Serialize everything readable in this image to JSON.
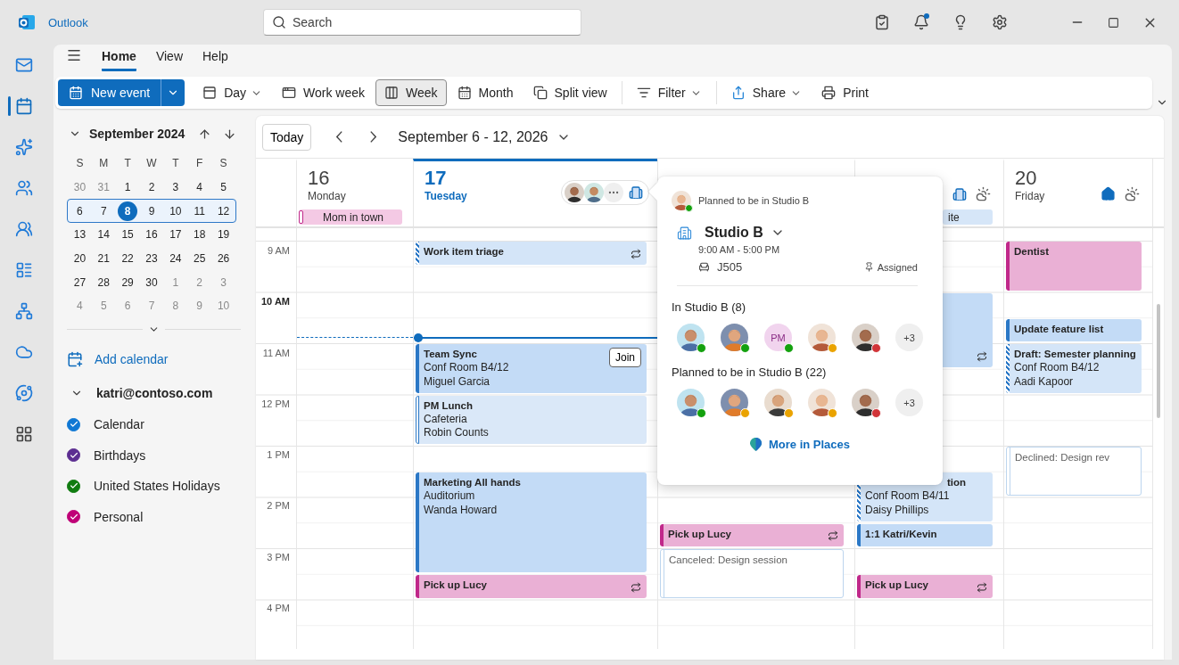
{
  "title_bar": {
    "app_name": "Outlook",
    "search_placeholder": "Search",
    "notification": true
  },
  "rail": [
    {
      "selected": false
    },
    {
      "selected": true
    },
    {
      "selected": false
    },
    {
      "selected": false
    },
    {
      "selected": false
    },
    {
      "selected": false
    },
    {
      "selected": false
    },
    {
      "selected": false
    },
    {
      "selected": false
    },
    {
      "selected": false
    }
  ],
  "tabs": [
    {
      "label": "Home",
      "selected": true
    },
    {
      "label": "View",
      "selected": false
    },
    {
      "label": "Help",
      "selected": false
    }
  ],
  "ribbon": {
    "new_event": "New event",
    "groups": [
      [
        {
          "kind": "view",
          "label": "Day",
          "dropdown": true,
          "selected": false
        },
        {
          "kind": "view",
          "label": "Work week",
          "dropdown": false,
          "selected": false
        },
        {
          "kind": "view",
          "label": "Week",
          "dropdown": false,
          "selected": true
        },
        {
          "kind": "view",
          "label": "Month",
          "dropdown": false,
          "selected": false
        },
        {
          "kind": "view",
          "label": "Split view",
          "dropdown": false,
          "selected": false
        }
      ],
      [
        {
          "kind": "action",
          "label": "Filter",
          "dropdown": true
        }
      ],
      [
        {
          "kind": "action",
          "label": "Share",
          "dropdown": true
        },
        {
          "kind": "action",
          "label": "Print",
          "dropdown": false
        }
      ]
    ]
  },
  "mini_calendar": {
    "month": "September 2024",
    "weekdays": [
      "S",
      "M",
      "T",
      "W",
      "T",
      "F",
      "S"
    ],
    "weeks": [
      {
        "selected": false,
        "days": [
          {
            "label": "30",
            "other_month": true,
            "selected": false
          },
          {
            "label": "31",
            "other_month": true,
            "selected": false
          },
          {
            "label": "1",
            "other_month": false,
            "selected": false
          },
          {
            "label": "2",
            "other_month": false,
            "selected": false
          },
          {
            "label": "3",
            "other_month": false,
            "selected": false
          },
          {
            "label": "4",
            "other_month": false,
            "selected": false
          },
          {
            "label": "5",
            "other_month": false,
            "selected": false
          }
        ]
      },
      {
        "selected": true,
        "days": [
          {
            "label": "6",
            "other_month": false,
            "selected": false
          },
          {
            "label": "7",
            "other_month": false,
            "selected": false
          },
          {
            "label": "8",
            "other_month": false,
            "selected": true
          },
          {
            "label": "9",
            "other_month": false,
            "selected": false
          },
          {
            "label": "10",
            "other_month": false,
            "selected": false
          },
          {
            "label": "11",
            "other_month": false,
            "selected": false
          },
          {
            "label": "12",
            "other_month": false,
            "selected": false
          }
        ]
      },
      {
        "selected": false,
        "days": [
          {
            "label": "13",
            "other_month": false,
            "selected": false
          },
          {
            "label": "14",
            "other_month": false,
            "selected": false
          },
          {
            "label": "15",
            "other_month": false,
            "selected": false
          },
          {
            "label": "16",
            "other_month": false,
            "selected": false
          },
          {
            "label": "17",
            "other_month": false,
            "selected": false
          },
          {
            "label": "18",
            "other_month": false,
            "selected": false
          },
          {
            "label": "19",
            "other_month": false,
            "selected": false
          }
        ]
      },
      {
        "selected": false,
        "days": [
          {
            "label": "20",
            "other_month": false,
            "selected": false
          },
          {
            "label": "21",
            "other_month": false,
            "selected": false
          },
          {
            "label": "22",
            "other_month": false,
            "selected": false
          },
          {
            "label": "23",
            "other_month": false,
            "selected": false
          },
          {
            "label": "24",
            "other_month": false,
            "selected": false
          },
          {
            "label": "25",
            "other_month": false,
            "selected": false
          },
          {
            "label": "26",
            "other_month": false,
            "selected": false
          }
        ]
      },
      {
        "selected": false,
        "days": [
          {
            "label": "27",
            "other_month": false,
            "selected": false
          },
          {
            "label": "28",
            "other_month": false,
            "selected": false
          },
          {
            "label": "29",
            "other_month": false,
            "selected": false
          },
          {
            "label": "30",
            "other_month": false,
            "selected": false
          },
          {
            "label": "1",
            "other_month": true,
            "selected": false
          },
          {
            "label": "2",
            "other_month": true,
            "selected": false
          },
          {
            "label": "3",
            "other_month": true,
            "selected": false
          }
        ]
      },
      {
        "selected": false,
        "days": [
          {
            "label": "4",
            "other_month": true,
            "selected": false
          },
          {
            "label": "5",
            "other_month": true,
            "selected": false
          },
          {
            "label": "6",
            "other_month": true,
            "selected": false
          },
          {
            "label": "7",
            "other_month": true,
            "selected": false
          },
          {
            "label": "8",
            "other_month": true,
            "selected": false
          },
          {
            "label": "9",
            "other_month": true,
            "selected": false
          },
          {
            "label": "10",
            "other_month": true,
            "selected": false
          }
        ]
      }
    ]
  },
  "add_calendar": "Add calendar",
  "account": {
    "name": "katri@contoso.com",
    "expanded": true,
    "calendars": [
      {
        "label": "Calendar",
        "color": "#0f78d4",
        "checked": true
      },
      {
        "label": "Birthdays",
        "color": "#5c2e91",
        "checked": true
      },
      {
        "label": "United States Holidays",
        "color": "#107c10",
        "checked": true
      },
      {
        "label": "Personal",
        "color": "#bf0077",
        "checked": true
      }
    ]
  },
  "calendar": {
    "today_button": "Today",
    "range": "September 6 - 12, 2026",
    "hours": [
      {
        "label": "9 AM",
        "current": false
      },
      {
        "label": "10 AM",
        "current": true
      },
      {
        "label": "11 AM",
        "current": false
      },
      {
        "label": "12 PM",
        "current": false
      },
      {
        "label": "1 PM",
        "current": false
      },
      {
        "label": "2 PM",
        "current": false
      },
      {
        "label": "3 PM",
        "current": false
      },
      {
        "label": "4 PM",
        "current": false
      }
    ],
    "days": [
      {
        "number": "16",
        "name": "Monday",
        "today": false,
        "all_day": [
          {
            "title": "Mom in town",
            "kind": "personal"
          }
        ]
      },
      {
        "number": "17",
        "name": "Tuesday",
        "today": true,
        "workplace": {
          "kind": "office"
        },
        "attendees": [
          {
            "kind": "photo"
          },
          {
            "kind": "photo"
          },
          {
            "kind": "more"
          }
        ],
        "slots": [
          {
            "kind": "event",
            "event": {
              "kind": "tentative",
              "title": "Work item triage",
              "recurring": true
            }
          },
          {
            "kind": "open"
          },
          {
            "kind": "open"
          },
          {
            "kind": "open"
          },
          {
            "kind": "event",
            "event": {
              "kind": "busy",
              "title": "Team Sync",
              "lines": [
                "Conf Room B4/12",
                "Miguel Garcia"
              ],
              "join": "Join",
              "recurring": false
            }
          },
          {
            "kind": "continued"
          },
          {
            "kind": "event",
            "event": {
              "kind": "free",
              "title": "PM Lunch",
              "lines": [
                "Cafeteria",
                "Robin Counts"
              ],
              "recurring": false
            }
          },
          {
            "kind": "continued"
          },
          {
            "kind": "open"
          },
          {
            "kind": "event",
            "event": {
              "kind": "busy",
              "title": "Marketing All hands",
              "lines": [
                "Auditorium",
                "Wanda Howard"
              ],
              "recurring": false
            }
          },
          {
            "kind": "continued"
          },
          {
            "kind": "continued"
          },
          {
            "kind": "continued"
          },
          {
            "kind": "event",
            "event": {
              "kind": "personal",
              "title": "Pick up Lucy",
              "recurring": true
            }
          }
        ]
      },
      {
        "today": false,
        "slots": [
          {
            "kind": "open"
          },
          {
            "kind": "open"
          },
          {
            "kind": "open"
          },
          {
            "kind": "open"
          },
          {
            "kind": "open"
          },
          {
            "kind": "open"
          },
          {
            "kind": "open"
          },
          {
            "kind": "open"
          },
          {
            "kind": "open"
          },
          {
            "kind": "open"
          },
          {
            "kind": "open"
          },
          {
            "kind": "event",
            "event": {
              "kind": "personal",
              "title": "Pick up Lucy",
              "recurring": true
            }
          },
          {
            "kind": "event",
            "event": {
              "kind": "canceled",
              "title": "Canceled: Design session",
              "recurring": false
            }
          },
          {
            "kind": "continued"
          }
        ]
      },
      {
        "today": false,
        "workplace": {
          "kind": "office"
        },
        "weather": true,
        "all_day": [
          {
            "title": "ite",
            "kind": "busy",
            "title_covered": true
          }
        ],
        "slots": [
          {
            "kind": "open"
          },
          {
            "kind": "open"
          },
          {
            "kind": "event",
            "event": {
              "kind": "busy",
              "recurring": true
            }
          },
          {
            "kind": "continued"
          },
          {
            "kind": "continued"
          },
          {
            "kind": "open"
          },
          {
            "kind": "open"
          },
          {
            "kind": "open"
          },
          {
            "kind": "open"
          },
          {
            "kind": "event",
            "event": {
              "kind": "tentative",
              "title": "tion",
              "title_covered": true,
              "lines": [
                "Conf Room B4/11",
                "Daisy Phillips"
              ],
              "recurring": false
            }
          },
          {
            "kind": "continued"
          },
          {
            "kind": "event",
            "event": {
              "kind": "busy",
              "title": "1:1 Katri/Kevin",
              "recurring": false
            }
          },
          {
            "kind": "open"
          },
          {
            "kind": "event",
            "event": {
              "kind": "personal",
              "title": "Pick up Lucy",
              "recurring": true
            }
          }
        ]
      },
      {
        "number": "20",
        "name": "Friday",
        "today": false,
        "workplace": {
          "kind": "home"
        },
        "weather": true,
        "slots": [
          {
            "kind": "event",
            "event": {
              "kind": "personal",
              "title": "Dentist",
              "recurring": false
            }
          },
          {
            "kind": "continued"
          },
          {
            "kind": "open"
          },
          {
            "kind": "event",
            "event": {
              "kind": "busy",
              "title": "Update feature list",
              "recurring": false
            }
          },
          {
            "kind": "event",
            "event": {
              "kind": "tentative",
              "title": "Draft: Semester planning",
              "lines": [
                "Conf Room B4/12",
                "Aadi Kapoor"
              ],
              "recurring": false
            }
          },
          {
            "kind": "continued"
          },
          {
            "kind": "open"
          },
          {
            "kind": "open"
          },
          {
            "kind": "event",
            "event": {
              "kind": "canceled",
              "title": "Declined: Design rev",
              "recurring": false
            }
          },
          {
            "kind": "continued"
          }
        ]
      }
    ]
  },
  "popup": {
    "status": {
      "text": "Planned to be in Studio B",
      "color": "#13a10e"
    },
    "place": "Studio B",
    "hours": "9:00 AM - 5:00 PM",
    "desk": "J505",
    "desk_status": "Assigned",
    "groups": [
      {
        "heading": "In Studio B (8)",
        "people": [
          {
            "kind": "photo",
            "color": "#13a10e"
          },
          {
            "kind": "photo",
            "color": "#13a10e"
          },
          {
            "kind": "initials",
            "initials": "PM",
            "color": "#13a10e"
          },
          {
            "kind": "photo",
            "color": "#eaa300"
          },
          {
            "kind": "photo",
            "color": "#d13438"
          },
          {
            "kind": "more",
            "label": "+3"
          }
        ]
      },
      {
        "heading": "Planned to be in Studio B (22)",
        "people": [
          {
            "kind": "photo",
            "color": "#13a10e"
          },
          {
            "kind": "photo",
            "color": "#eaa300"
          },
          {
            "kind": "photo",
            "color": "#eaa300"
          },
          {
            "kind": "photo",
            "color": "#eaa300"
          },
          {
            "kind": "photo",
            "color": "#d13438"
          },
          {
            "kind": "more",
            "label": "+3"
          }
        ]
      }
    ],
    "link": "More in Places"
  }
}
